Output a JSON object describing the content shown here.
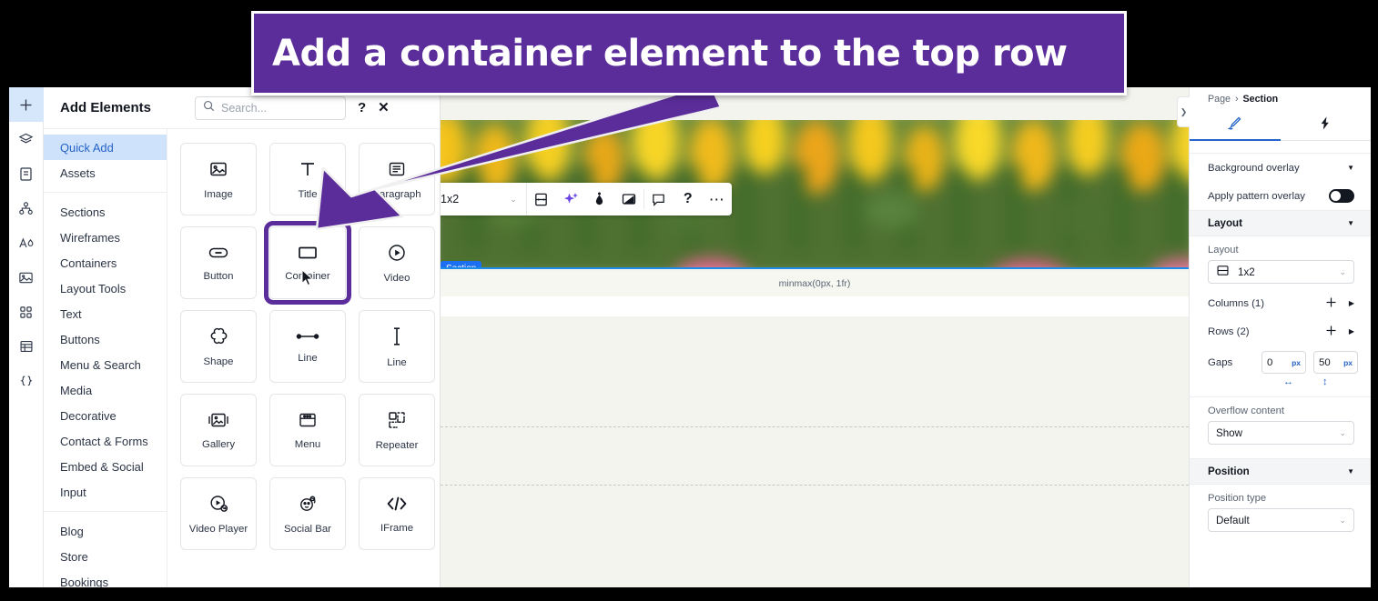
{
  "callout": {
    "text": "Add a container element to the top row",
    "bg": "#5b2d9a"
  },
  "icon_rail": [
    {
      "name": "add",
      "icon": "plus-icon",
      "active": true
    },
    {
      "name": "layers",
      "icon": "layers-icon",
      "active": false
    },
    {
      "name": "pages",
      "icon": "page-icon",
      "active": false
    },
    {
      "name": "site-structure",
      "icon": "sitemap-icon",
      "active": false
    },
    {
      "name": "theme",
      "icon": "theme-icon",
      "active": false
    },
    {
      "name": "media",
      "icon": "image-icon",
      "active": false
    },
    {
      "name": "apps",
      "icon": "apps-grid-icon",
      "active": false
    },
    {
      "name": "cms",
      "icon": "table-icon",
      "active": false
    },
    {
      "name": "dev-mode",
      "icon": "code-braces-icon",
      "active": false
    }
  ],
  "panel": {
    "title": "Add Elements",
    "search_placeholder": "Search...",
    "help_label": "?",
    "close_label": "✕"
  },
  "categories": {
    "group1": [
      {
        "label": "Quick Add",
        "active": true
      },
      {
        "label": "Assets",
        "active": false
      }
    ],
    "group2": [
      {
        "label": "Sections",
        "active": false
      },
      {
        "label": "Wireframes",
        "active": false
      },
      {
        "label": "Containers",
        "active": false
      },
      {
        "label": "Layout Tools",
        "active": false
      },
      {
        "label": "Text",
        "active": false
      },
      {
        "label": "Buttons",
        "active": false
      },
      {
        "label": "Menu & Search",
        "active": false
      },
      {
        "label": "Media",
        "active": false
      },
      {
        "label": "Decorative",
        "active": false
      },
      {
        "label": "Contact & Forms",
        "active": false
      },
      {
        "label": "Embed & Social",
        "active": false
      },
      {
        "label": "Input",
        "active": false
      }
    ],
    "group3": [
      {
        "label": "Blog",
        "active": false
      },
      {
        "label": "Store",
        "active": false
      },
      {
        "label": "Bookings",
        "active": false
      }
    ]
  },
  "elements": [
    {
      "label": "Image",
      "icon": "image-tile-icon",
      "selected": false
    },
    {
      "label": "Title",
      "icon": "title-tile-icon",
      "selected": false
    },
    {
      "label": "Paragraph",
      "icon": "paragraph-tile-icon",
      "selected": false
    },
    {
      "label": "Button",
      "icon": "button-tile-icon",
      "selected": false
    },
    {
      "label": "Container",
      "icon": "container-tile-icon",
      "selected": true
    },
    {
      "label": "Video",
      "icon": "video-tile-icon",
      "selected": false
    },
    {
      "label": "Shape",
      "icon": "shape-tile-icon",
      "selected": false
    },
    {
      "label": "Line",
      "icon": "line-horizontal-icon",
      "selected": false
    },
    {
      "label": "Line",
      "icon": "line-vertical-icon",
      "selected": false
    },
    {
      "label": "Gallery",
      "icon": "gallery-tile-icon",
      "selected": false
    },
    {
      "label": "Menu",
      "icon": "menu-tile-icon",
      "selected": false
    },
    {
      "label": "Repeater",
      "icon": "repeater-tile-icon",
      "selected": false
    },
    {
      "label": "Video Player",
      "icon": "video-player-tile-icon",
      "selected": false
    },
    {
      "label": "Social Bar",
      "icon": "social-bar-tile-icon",
      "selected": false
    },
    {
      "label": "IFrame",
      "icon": "iframe-tile-icon",
      "selected": false
    }
  ],
  "canvas": {
    "section_tag": "Section",
    "row_label": "minmax(0px, 1fr)",
    "toolbar": {
      "layout_value": "1x2",
      "icons": [
        "layout-grid-icon",
        "ai-sparkle-icon",
        "eyedropper-icon",
        "screen-icon",
        "comment-icon",
        "help-icon",
        "more-icon"
      ]
    }
  },
  "inspector": {
    "breadcrumb_parent": "Page",
    "breadcrumb_sep": "›",
    "breadcrumb_current": "Section",
    "tabs": [
      {
        "name": "design",
        "icon": "brush-icon",
        "active": true
      },
      {
        "name": "interactions",
        "icon": "lightning-icon",
        "active": false
      }
    ],
    "background_overlay_label": "Background overlay",
    "apply_pattern_label": "Apply pattern overlay",
    "apply_pattern_on": true,
    "layout_section": "Layout",
    "layout_field_label": "Layout",
    "layout_value": "1x2",
    "columns_label": "Columns (1)",
    "rows_label": "Rows (2)",
    "gaps_label": "Gaps",
    "gap_horizontal": "0",
    "gap_vertical": "50",
    "gap_unit": "px",
    "overflow_label": "Overflow content",
    "overflow_value": "Show",
    "position_section": "Position",
    "position_type_label": "Position type",
    "position_type_value": "Default",
    "collapse_chevron": "❯",
    "accent": "#2463c9"
  }
}
